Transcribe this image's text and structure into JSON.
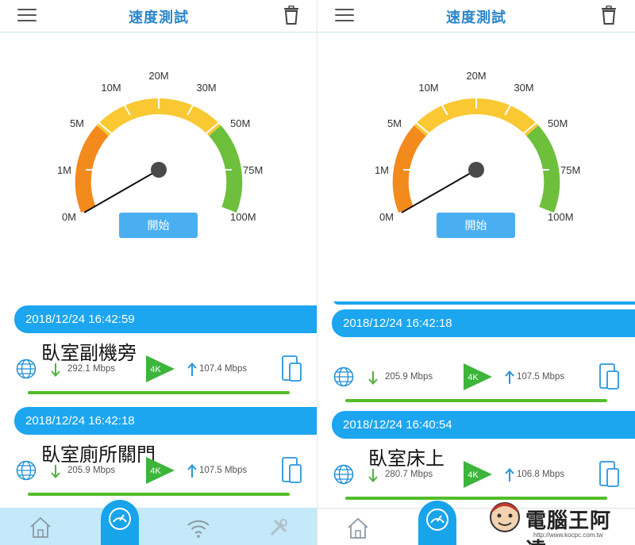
{
  "header": {
    "title": "速度測試"
  },
  "gauge": {
    "ticks": [
      "0M",
      "1M",
      "5M",
      "10M",
      "20M",
      "30M",
      "50M",
      "75M",
      "100M"
    ],
    "start_label": "開始",
    "colors": {
      "orange": "#f28a1c",
      "yellow": "#f9c833",
      "green": "#6dbf3c"
    }
  },
  "left": {
    "records": [
      {
        "date": "2018/12/24 16:42:59",
        "location": "臥室副機旁",
        "download": "292.1 Mbps",
        "upload": "107.4 Mbps"
      },
      {
        "date": "2018/12/24 16:42:18",
        "location": "臥室廁所關門",
        "download": "205.9 Mbps",
        "upload": "107.5 Mbps"
      }
    ]
  },
  "right": {
    "records": [
      {
        "date": "2018/12/24 16:42:18",
        "location": "",
        "download": "205.9 Mbps",
        "upload": "107.5 Mbps"
      },
      {
        "date": "2018/12/24 16:40:54",
        "location": "臥室床上",
        "download": "280.7 Mbps",
        "upload": "106.8 Mbps"
      }
    ]
  },
  "badge_label": "4K",
  "watermark": {
    "text": "電腦王阿達",
    "url": "http://www.kocpc.com.tw"
  },
  "colors": {
    "accent": "#1ba6ef",
    "title": "#2a86c8",
    "bar": "#52bd2a"
  }
}
